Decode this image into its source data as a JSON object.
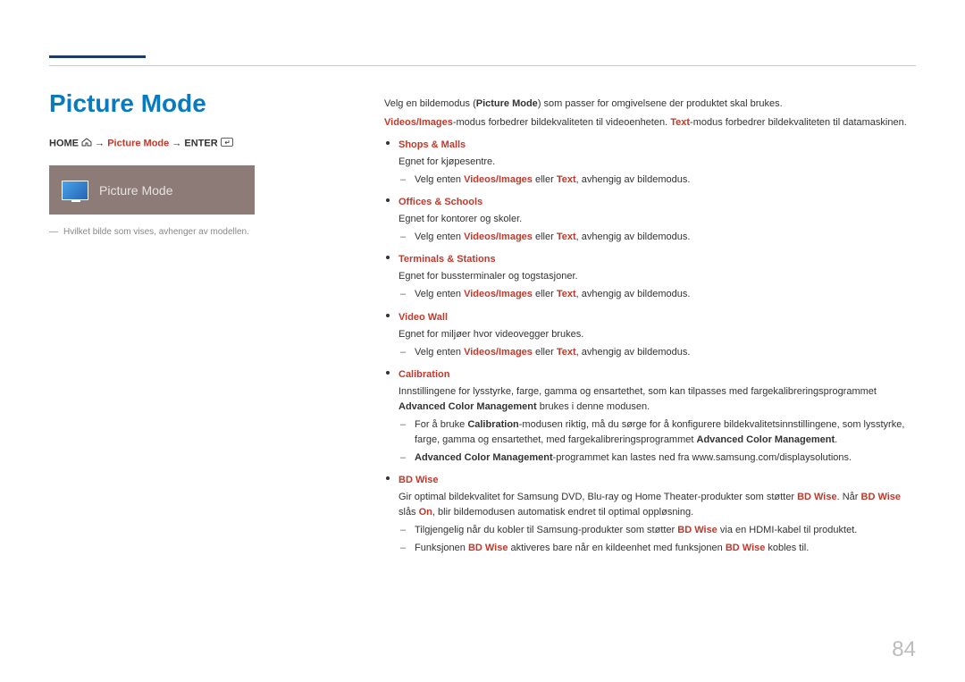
{
  "header": {
    "title": "Picture Mode"
  },
  "nav": {
    "home": "HOME",
    "arrow": "→",
    "mid": "Picture Mode",
    "enter": "ENTER"
  },
  "preview": {
    "label": "Picture Mode"
  },
  "left_footnote": "Hvilket bilde som vises, avhenger av modellen.",
  "intro": {
    "p1_a": "Velg en bildemodus (",
    "p1_b": "Picture Mode",
    "p1_c": ") som passer for omgivelsene der produktet skal brukes.",
    "p2_a": "Videos/Images",
    "p2_b": "-modus forbedrer bildekvaliteten til videoenheten. ",
    "p2_c": "Text",
    "p2_d": "-modus forbedrer bildekvaliteten til datamaskinen."
  },
  "modes": {
    "shops": {
      "title": "Shops & Malls",
      "desc": "Egnet for kjøpesentre.",
      "sub_a": "Velg enten ",
      "sub_b": "Videos/Images",
      "sub_c": " eller ",
      "sub_d": "Text",
      "sub_e": ", avhengig av bildemodus."
    },
    "offices": {
      "title": "Offices & Schools",
      "desc": "Egnet for kontorer og skoler.",
      "sub_a": "Velg enten ",
      "sub_b": "Videos/Images",
      "sub_c": " eller ",
      "sub_d": "Text",
      "sub_e": ", avhengig av bildemodus."
    },
    "terminals": {
      "title": "Terminals & Stations",
      "desc": "Egnet for bussterminaler og togstasjoner.",
      "sub_a": "Velg enten ",
      "sub_b": "Videos/Images",
      "sub_c": " eller ",
      "sub_d": "Text",
      "sub_e": ", avhengig av bildemodus."
    },
    "videowall": {
      "title": "Video Wall",
      "desc": "Egnet for miljøer hvor videovegger brukes.",
      "sub_a": "Velg enten ",
      "sub_b": "Videos/Images",
      "sub_c": " eller ",
      "sub_d": "Text",
      "sub_e": ", avhengig av bildemodus."
    },
    "calibration": {
      "title": "Calibration",
      "desc_a": "Innstillingene for lysstyrke, farge, gamma og ensartethet, som kan tilpasses med fargekalibreringsprogrammet ",
      "desc_b": "Advanced Color Management",
      "desc_c": " brukes i denne modusen.",
      "sub1_a": "For å bruke ",
      "sub1_b": "Calibration",
      "sub1_c": "-modusen riktig, må du sørge for å konfigurere bildekvalitetsinnstillingene, som lysstyrke, farge, gamma og ensartethet, med fargekalibreringsprogrammet ",
      "sub1_d": "Advanced Color Management",
      "sub1_e": ".",
      "sub2_a": "Advanced Color Management",
      "sub2_b": "-programmet kan lastes ned fra www.samsung.com/displaysolutions."
    },
    "bdwise": {
      "title": "BD Wise",
      "desc_a": "Gir optimal bildekvalitet for Samsung DVD, Blu-ray og Home Theater-produkter som støtter ",
      "desc_b": "BD Wise",
      "desc_c": ". Når ",
      "desc_d": "BD Wise",
      "desc_e": " slås ",
      "desc_f": "On",
      "desc_g": ", blir bildemodusen automatisk endret til optimal oppløsning.",
      "sub1_a": "Tilgjengelig når du kobler til Samsung-produkter som støtter ",
      "sub1_b": "BD Wise",
      "sub1_c": " via en HDMI-kabel til produktet.",
      "sub2_a": "Funksjonen ",
      "sub2_b": "BD Wise",
      "sub2_c": " aktiveres bare når en kildeenhet med funksjonen ",
      "sub2_d": "BD Wise",
      "sub2_e": " kobles til."
    }
  },
  "pagenum": "84"
}
